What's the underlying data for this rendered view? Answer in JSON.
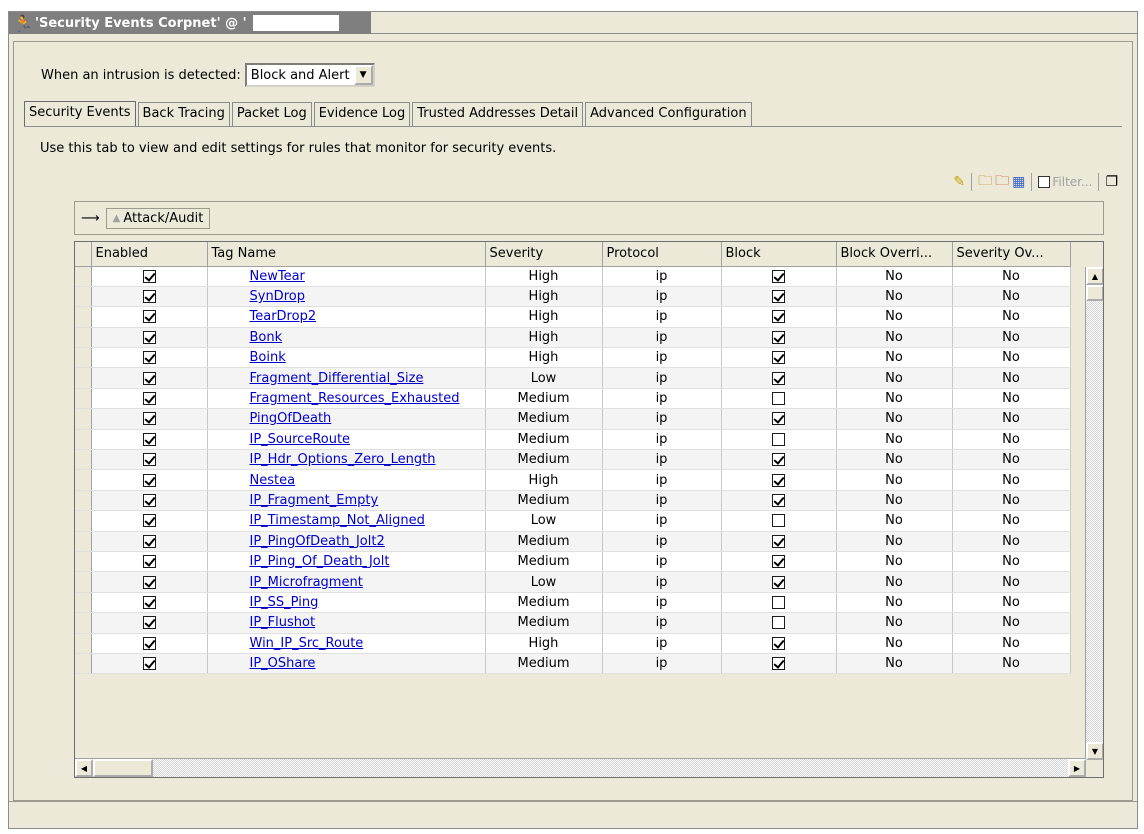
{
  "window": {
    "title": "'Security Events Corpnet' @ '",
    "icon": "intrusion-runner-icon"
  },
  "intrusion": {
    "label": "When an intrusion is detected:",
    "selected": "Block and Alert"
  },
  "tabs": [
    {
      "label": "Security Events",
      "active": true
    },
    {
      "label": "Back Tracing",
      "active": false
    },
    {
      "label": "Packet Log",
      "active": false
    },
    {
      "label": "Evidence Log",
      "active": false
    },
    {
      "label": "Trusted Addresses Detail",
      "active": false
    },
    {
      "label": "Advanced Configuration",
      "active": false
    }
  ],
  "description": "Use this tab to view and edit settings for rules that monitor for security events.",
  "toolbar": {
    "filter_placeholder": "Filter...",
    "icons": [
      "edit-pencil-icon",
      "add-rule-icon",
      "delete-rule-icon",
      "columns-icon",
      "filter-checkbox-icon",
      "copy-icon"
    ]
  },
  "groupby": {
    "arrow": "⟶",
    "sort_indicator": "▲",
    "chip_label": "Attack/Audit"
  },
  "grid": {
    "columns": [
      "Enabled",
      "Tag Name",
      "Severity",
      "Protocol",
      "Block",
      "Block Overri...",
      "Severity Ov..."
    ],
    "rows": [
      {
        "enabled": true,
        "tag": "NewTear",
        "severity": "High",
        "protocol": "ip",
        "block": true,
        "block_override": "No",
        "severity_override": "No"
      },
      {
        "enabled": true,
        "tag": "SynDrop",
        "severity": "High",
        "protocol": "ip",
        "block": true,
        "block_override": "No",
        "severity_override": "No"
      },
      {
        "enabled": true,
        "tag": "TearDrop2",
        "severity": "High",
        "protocol": "ip",
        "block": true,
        "block_override": "No",
        "severity_override": "No"
      },
      {
        "enabled": true,
        "tag": "Bonk",
        "severity": "High",
        "protocol": "ip",
        "block": true,
        "block_override": "No",
        "severity_override": "No"
      },
      {
        "enabled": true,
        "tag": "Boink",
        "severity": "High",
        "protocol": "ip",
        "block": true,
        "block_override": "No",
        "severity_override": "No"
      },
      {
        "enabled": true,
        "tag": "Fragment_Differential_Size",
        "severity": "Low",
        "protocol": "ip",
        "block": true,
        "block_override": "No",
        "severity_override": "No"
      },
      {
        "enabled": true,
        "tag": "Fragment_Resources_Exhausted",
        "severity": "Medium",
        "protocol": "ip",
        "block": false,
        "block_override": "No",
        "severity_override": "No"
      },
      {
        "enabled": true,
        "tag": "PingOfDeath",
        "severity": "Medium",
        "protocol": "ip",
        "block": true,
        "block_override": "No",
        "severity_override": "No"
      },
      {
        "enabled": true,
        "tag": "IP_SourceRoute",
        "severity": "Medium",
        "protocol": "ip",
        "block": false,
        "block_override": "No",
        "severity_override": "No"
      },
      {
        "enabled": true,
        "tag": "IP_Hdr_Options_Zero_Length",
        "severity": "Medium",
        "protocol": "ip",
        "block": true,
        "block_override": "No",
        "severity_override": "No"
      },
      {
        "enabled": true,
        "tag": "Nestea",
        "severity": "High",
        "protocol": "ip",
        "block": true,
        "block_override": "No",
        "severity_override": "No"
      },
      {
        "enabled": true,
        "tag": "IP_Fragment_Empty",
        "severity": "Medium",
        "protocol": "ip",
        "block": true,
        "block_override": "No",
        "severity_override": "No"
      },
      {
        "enabled": true,
        "tag": "IP_Timestamp_Not_Aligned",
        "severity": "Low",
        "protocol": "ip",
        "block": false,
        "block_override": "No",
        "severity_override": "No"
      },
      {
        "enabled": true,
        "tag": "IP_PingOfDeath_Jolt2",
        "severity": "Medium",
        "protocol": "ip",
        "block": true,
        "block_override": "No",
        "severity_override": "No"
      },
      {
        "enabled": true,
        "tag": "IP_Ping_Of_Death_Jolt",
        "severity": "Medium",
        "protocol": "ip",
        "block": true,
        "block_override": "No",
        "severity_override": "No"
      },
      {
        "enabled": true,
        "tag": "IP_Microfragment",
        "severity": "Low",
        "protocol": "ip",
        "block": true,
        "block_override": "No",
        "severity_override": "No"
      },
      {
        "enabled": true,
        "tag": "IP_SS_Ping",
        "severity": "Medium",
        "protocol": "ip",
        "block": false,
        "block_override": "No",
        "severity_override": "No"
      },
      {
        "enabled": true,
        "tag": "IP_Flushot",
        "severity": "Medium",
        "protocol": "ip",
        "block": false,
        "block_override": "No",
        "severity_override": "No"
      },
      {
        "enabled": true,
        "tag": "Win_IP_Src_Route",
        "severity": "High",
        "protocol": "ip",
        "block": true,
        "block_override": "No",
        "severity_override": "No"
      },
      {
        "enabled": true,
        "tag": "IP_OShare",
        "severity": "Medium",
        "protocol": "ip",
        "block": true,
        "block_override": "No",
        "severity_override": "No"
      }
    ]
  }
}
